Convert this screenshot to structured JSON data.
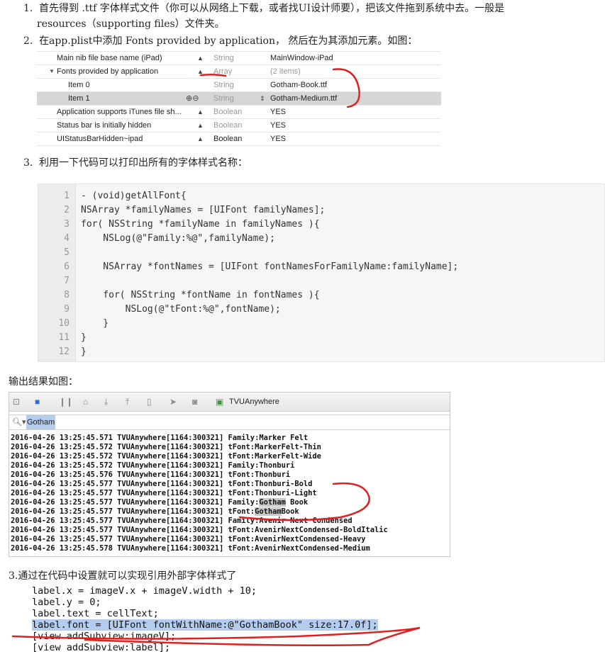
{
  "steps": {
    "s1_num": "1.",
    "s1_line1": "首先得到 .ttf 字体样式文件（你可以从网络上下载，或者找UI设计师要），把该文件拖到系统中去。一般是",
    "s1_line2": "resources（supporting files）文件夹。",
    "s2_num": "2.",
    "s2_text": "在app.plist中添加 Fonts provided by application， 然后在为其添加元素。如图：",
    "s3_num": "3.",
    "s3_text": "利用一下代码可以打印出所有的字体样式名称：",
    "output_label": "输出结果如图：",
    "s4_text": "3.通过在代码中设置就可以实现引用外部字体样式了"
  },
  "plist": [
    {
      "key": "Main nib file base name (iPad)",
      "type": "String",
      "value": "MainWindow-iPad"
    },
    {
      "key": "Fonts provided by application",
      "type": "Array",
      "value": "(2 items)"
    },
    {
      "key": "Item 0",
      "type": "String",
      "value": "Gotham-Book.ttf"
    },
    {
      "key": "Item 1",
      "type": "String",
      "value": "Gotham-Medium.ttf"
    },
    {
      "key": "Application supports iTunes file sh...",
      "type": "Boolean",
      "value": "YES"
    },
    {
      "key": "Status bar is initially hidden",
      "type": "Boolean",
      "value": "YES"
    },
    {
      "key": "UIStatusBarHidden~ipad",
      "type": "Boolean",
      "value": "YES"
    }
  ],
  "code_lines": [
    {
      "n": "1",
      "t": "- (void)getAllFont{"
    },
    {
      "n": "2",
      "t": "NSArray *familyNames = [UIFont familyNames];"
    },
    {
      "n": "3",
      "t": "for( NSString *familyName in familyNames ){"
    },
    {
      "n": "4",
      "t": "    NSLog(@\"Family:%@\",familyName);"
    },
    {
      "n": "5",
      "t": ""
    },
    {
      "n": "6",
      "t": "    NSArray *fontNames = [UIFont fontNamesForFamilyName:familyName];"
    },
    {
      "n": "7",
      "t": ""
    },
    {
      "n": "8",
      "t": "    for( NSString *fontName in fontNames ){"
    },
    {
      "n": "9",
      "t": "        NSLog(@\"tFont:%@\",fontName);"
    },
    {
      "n": "10",
      "t": "    }"
    },
    {
      "n": "11",
      "t": "}"
    },
    {
      "n": "12",
      "t": "}"
    }
  ],
  "console": {
    "target": "TVUAnywhere",
    "filter": "Gotham",
    "logs": [
      "2016-04-26 13:25:45.571 TVUAnywhere[1164:300321] Family:Marker Felt",
      "2016-04-26 13:25:45.572 TVUAnywhere[1164:300321] tFont:MarkerFelt-Thin",
      "2016-04-26 13:25:45.572 TVUAnywhere[1164:300321] tFont:MarkerFelt-Wide",
      "2016-04-26 13:25:45.572 TVUAnywhere[1164:300321] Family:Thonburi",
      "2016-04-26 13:25:45.576 TVUAnywhere[1164:300321] tFont:Thonburi",
      "2016-04-26 13:25:45.577 TVUAnywhere[1164:300321] tFont:Thonburi-Bold",
      "2016-04-26 13:25:45.577 TVUAnywhere[1164:300321] tFont:Thonburi-Light",
      "2016-04-26 13:25:45.577 TVUAnywhere[1164:300321] Family:Gotham Book",
      "2016-04-26 13:25:45.577 TVUAnywhere[1164:300321] tFont:GothamBook",
      "2016-04-26 13:25:45.577 TVUAnywhere[1164:300321] Family:Avenir Next Condensed",
      "2016-04-26 13:25:45.577 TVUAnywhere[1164:300321] tFont:AvenirNextCondensed-BoldItalic",
      "2016-04-26 13:25:45.577 TVUAnywhere[1164:300321] tFont:AvenirNextCondensed-Heavy",
      "2016-04-26 13:25:45.578 TVUAnywhere[1164:300321] tFont:AvenirNextCondensed-Medium"
    ]
  },
  "code2": [
    "label.x = imageV.x + imageV.width + 10;",
    "label.y = 0;",
    "label.text = cellText;",
    "label.font = [UIFont fontWithName:@\"GothamBook\" size:17.0f];",
    "[view addSubview:imageV];",
    "[view addSubview:label];"
  ],
  "colors": {
    "annotation": "#e02020",
    "selection": "#b4cdef",
    "keyword": "#a020a0",
    "string": "#1a8a1a"
  }
}
